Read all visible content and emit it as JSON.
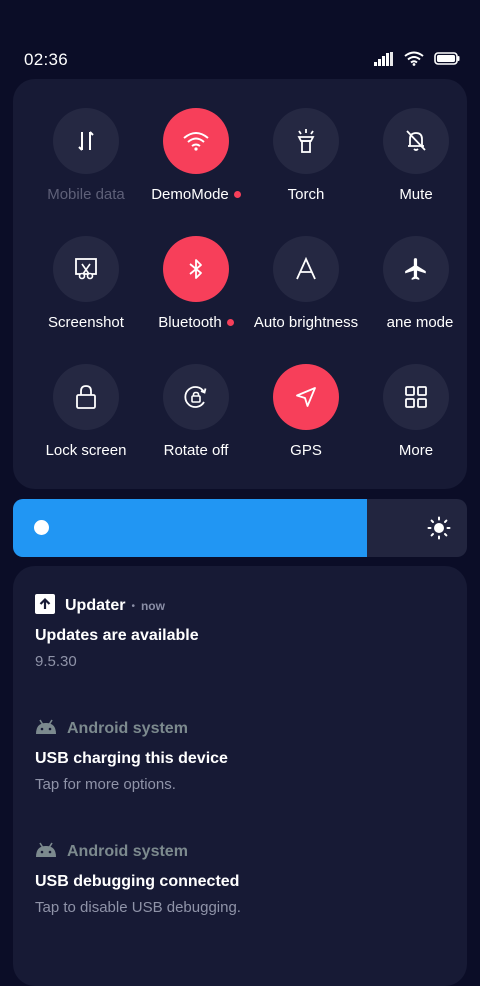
{
  "status_bar": {
    "time": "02:36",
    "icons": [
      "signal-icon",
      "wifi-icon",
      "battery-icon"
    ]
  },
  "quick_settings": {
    "tiles": [
      {
        "name": "mobile-data",
        "label": "Mobile data",
        "icon": "mobile-data-icon",
        "active": false,
        "disabled": true,
        "dot": false
      },
      {
        "name": "demomode",
        "label": "DemoMode",
        "icon": "wifi-icon",
        "active": true,
        "disabled": false,
        "dot": true
      },
      {
        "name": "torch",
        "label": "Torch",
        "icon": "flashlight-icon",
        "active": false,
        "disabled": false,
        "dot": false
      },
      {
        "name": "mute",
        "label": "Mute",
        "icon": "bell-off-icon",
        "active": false,
        "disabled": false,
        "dot": false
      },
      {
        "name": "screenshot",
        "label": "Screenshot",
        "icon": "screenshot-icon",
        "active": false,
        "disabled": false,
        "dot": false
      },
      {
        "name": "bluetooth",
        "label": "Bluetooth",
        "icon": "bluetooth-icon",
        "active": true,
        "disabled": false,
        "dot": true
      },
      {
        "name": "auto-brightness",
        "label": "Auto brightness",
        "icon": "auto-brightness-icon",
        "active": false,
        "disabled": false,
        "dot": false
      },
      {
        "name": "airplane-mode",
        "label": "ane mode",
        "icon": "airplane-icon",
        "active": false,
        "disabled": false,
        "dot": false
      },
      {
        "name": "lock-screen",
        "label": "Lock screen",
        "icon": "lock-icon",
        "active": false,
        "disabled": false,
        "dot": false
      },
      {
        "name": "rotate",
        "label": "Rotate off",
        "icon": "rotate-lock-icon",
        "active": false,
        "disabled": false,
        "dot": false
      },
      {
        "name": "gps",
        "label": "GPS",
        "icon": "navigation-icon",
        "active": true,
        "disabled": false,
        "dot": false
      },
      {
        "name": "more",
        "label": "More",
        "icon": "grid-icon",
        "active": false,
        "disabled": false,
        "dot": false
      }
    ]
  },
  "brightness": {
    "level": 0.78,
    "icon": "sun-icon"
  },
  "notifications": [
    {
      "app": "Updater",
      "icon": "upload-icon",
      "separator": "•",
      "time": "now",
      "title": "Updates are available",
      "body": "9.5.30"
    },
    {
      "app": "Android system",
      "icon": "android-icon",
      "separator": "",
      "time": "",
      "title": "USB charging this device",
      "body": "Tap for more options."
    },
    {
      "app": "Android system",
      "icon": "android-icon",
      "separator": "",
      "time": "",
      "title": "USB debugging connected",
      "body": "Tap to disable USB debugging."
    }
  ],
  "colors": {
    "background": "#0b0d27",
    "panel": "#171a35",
    "tile_inactive": "#252842",
    "accent_red": "#f73f5a",
    "brightness_blue": "#2196f3"
  }
}
